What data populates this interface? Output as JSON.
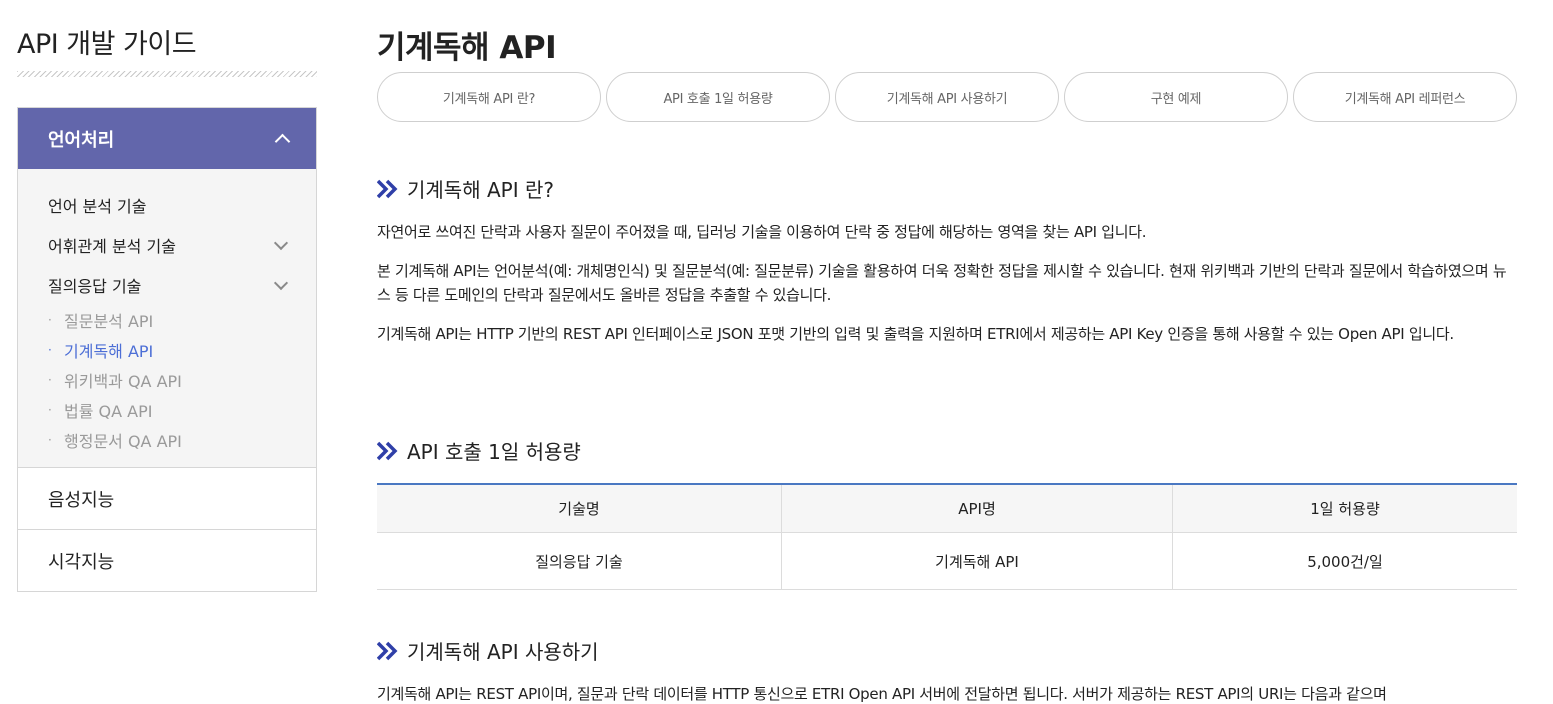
{
  "sidebar": {
    "guide_title": "API 개발 가이드",
    "active_category": "언어처리",
    "items": [
      {
        "label": "언어 분석 기술",
        "has_children": false
      },
      {
        "label": "어휘관계 분석 기술",
        "has_children": true
      },
      {
        "label": "질의응답 기술",
        "has_children": true
      }
    ],
    "leaves": [
      {
        "label": "질문분석 API",
        "active": false
      },
      {
        "label": "기계독해 API",
        "active": true
      },
      {
        "label": "위키백과 QA API",
        "active": false
      },
      {
        "label": "법률 QA API",
        "active": false
      },
      {
        "label": "행정문서 QA API",
        "active": false
      }
    ],
    "leaf_bullet": "·",
    "categories": [
      "음성지능",
      "시각지능"
    ]
  },
  "main": {
    "title": "기계독해 API",
    "tabs": [
      "기계독해 API 란?",
      "API 호출 1일 허용량",
      "기계독해 API 사용하기",
      "구현 예제",
      "기계독해 API 레퍼런스"
    ],
    "sections": [
      {
        "heading": "기계독해 API 란?"
      },
      {
        "heading": "API 호출 1일 허용량"
      },
      {
        "heading": "기계독해 API 사용하기"
      }
    ],
    "intro_paragraphs": [
      "자연어로 쓰여진 단락과 사용자 질문이 주어졌을 때, 딥러닝 기술을 이용하여 단락 중 정답에 해당하는 영역을 찾는 API 입니다.",
      "본 기계독해 API는 언어분석(예: 개체명인식) 및 질문분석(예: 질문분류) 기술을 활용하여 더욱 정확한 정답을 제시할 수 있습니다. 현재 위키백과 기반의 단락과 질문에서 학습하였으며 뉴스 등 다른 도메인의 단락과 질문에서도 올바른 정답을 추출할 수 있습니다.",
      "기계독해 API는 HTTP 기반의 REST API 인터페이스로 JSON 포맷 기반의 입력 및 출력을 지원하며 ETRI에서 제공하는 API Key 인증을 통해 사용할 수 있는 Open API 입니다."
    ],
    "quota_table": {
      "headers": [
        "기술명",
        "API명",
        "1일 허용량"
      ],
      "rows": [
        [
          "질의응답 기술",
          "기계독해 API",
          "5,000건/일"
        ]
      ]
    },
    "usage_text_partial": "기계독해 API는 REST API이며, 질문과 단락 데이터를 HTTP 통신으로 ETRI Open API 서버에 전달하면 됩니다. 서버가 제공하는 REST API의 URI는 다음과 같으며"
  },
  "colors": {
    "accent_purple": "#6266ab",
    "active_link": "#4d6fd6",
    "table_top_border": "#4a78c2",
    "section_chevron": "#2f3fa8"
  }
}
